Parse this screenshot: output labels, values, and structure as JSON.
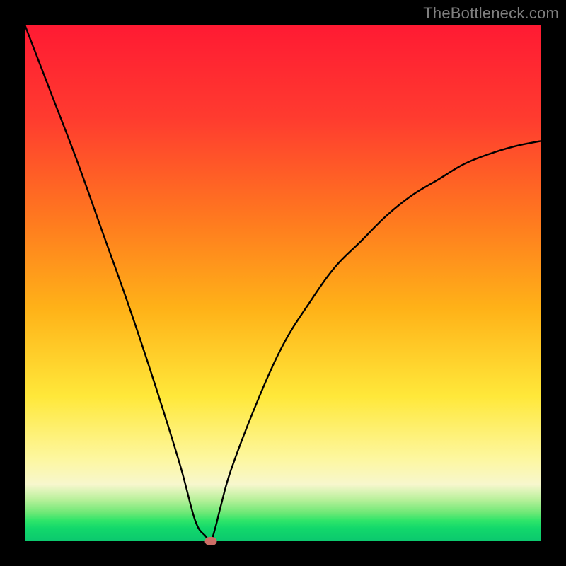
{
  "watermark": {
    "text": "TheBottleneck.com"
  },
  "chart_data": {
    "type": "line",
    "title": "",
    "xlabel": "",
    "ylabel": "",
    "xlim": [
      0,
      100
    ],
    "ylim": [
      0,
      100
    ],
    "grid": false,
    "legend": false,
    "series": [
      {
        "name": "curve",
        "x": [
          0,
          5,
          10,
          15,
          20,
          25,
          30,
          33,
          35,
          36,
          37,
          38,
          40,
          45,
          50,
          55,
          60,
          65,
          70,
          75,
          80,
          85,
          90,
          95,
          100
        ],
        "y": [
          100,
          87,
          74,
          60,
          46,
          31,
          15,
          4,
          1,
          0,
          3,
          7,
          14,
          27,
          38,
          46,
          53,
          58,
          63,
          67,
          70,
          73,
          75,
          76.5,
          77.5
        ]
      }
    ],
    "marker": {
      "x": 36,
      "y": 0,
      "color": "#cc6e66"
    },
    "background_gradient": {
      "top": "#ff1a33",
      "mid": "#ffe83a",
      "bottom": "#0bc86e"
    }
  }
}
